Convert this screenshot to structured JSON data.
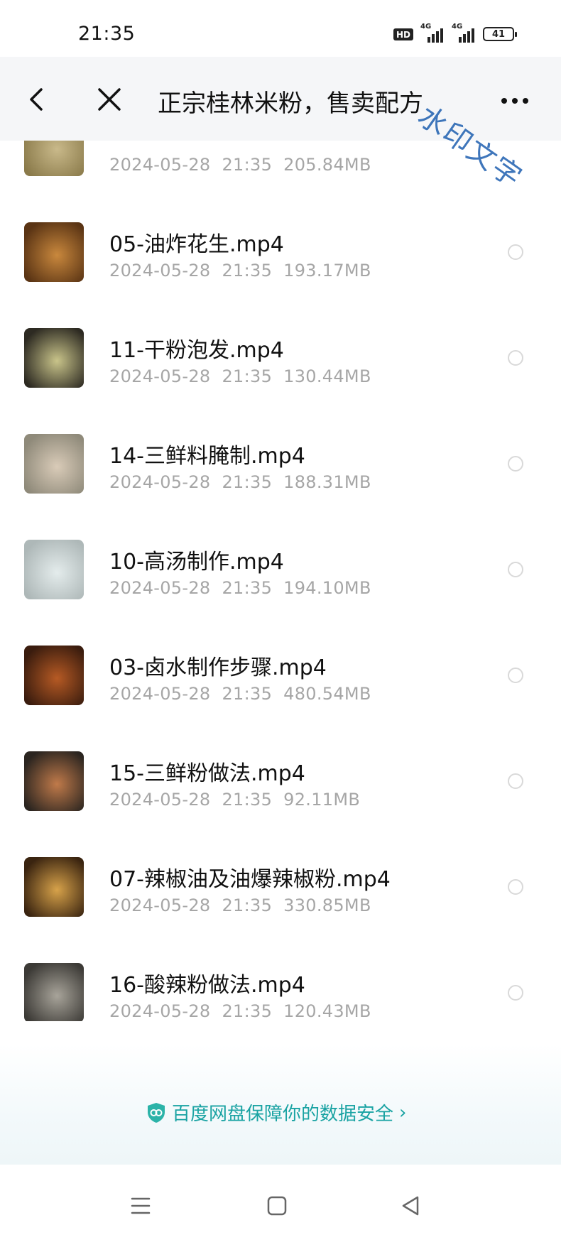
{
  "status_bar": {
    "time": "21:35",
    "hd_label": "HD",
    "net1_label": "4G",
    "net2_label": "4G",
    "battery_level": "41"
  },
  "header": {
    "title": "正宗桂林米粉，售卖配方",
    "back_icon": "chevron-left-icon",
    "close_icon": "close-icon",
    "more_icon": "more-icon",
    "watermark_text": "水印文字"
  },
  "files": [
    {
      "name": "",
      "date": "2024-05-28",
      "time": "21:35",
      "size": "205.84MB",
      "thumb_colors": [
        "#8a7a4a",
        "#c9b98a"
      ]
    },
    {
      "name": "05-油炸花生.mp4",
      "date": "2024-05-28",
      "time": "21:35",
      "size": "193.17MB",
      "thumb_colors": [
        "#5a3414",
        "#c9883d"
      ]
    },
    {
      "name": "11-干粉泡发.mp4",
      "date": "2024-05-28",
      "time": "21:35",
      "size": "130.44MB",
      "thumb_colors": [
        "#2d2a22",
        "#c9c48a"
      ]
    },
    {
      "name": "14-三鲜料腌制.mp4",
      "date": "2024-05-28",
      "time": "21:35",
      "size": "188.31MB",
      "thumb_colors": [
        "#8f8a7a",
        "#d9cbb8"
      ]
    },
    {
      "name": "10-高汤制作.mp4",
      "date": "2024-05-28",
      "time": "21:35",
      "size": "194.10MB",
      "thumb_colors": [
        "#aeb8b8",
        "#e4ecec"
      ]
    },
    {
      "name": "03-卤水制作步骤.mp4",
      "date": "2024-05-28",
      "time": "21:35",
      "size": "480.54MB",
      "thumb_colors": [
        "#3a1c0e",
        "#b65a24"
      ]
    },
    {
      "name": "15-三鲜粉做法.mp4",
      "date": "2024-05-28",
      "time": "21:35",
      "size": "92.11MB",
      "thumb_colors": [
        "#2b2520",
        "#c07a4a"
      ]
    },
    {
      "name": "07-辣椒油及油爆辣椒粉.mp4",
      "date": "2024-05-28",
      "time": "21:35",
      "size": "330.85MB",
      "thumb_colors": [
        "#3a2410",
        "#d7a24a"
      ]
    },
    {
      "name": "16-酸辣粉做法.mp4",
      "date": "2024-05-28",
      "time": "21:35",
      "size": "120.43MB",
      "thumb_colors": [
        "#3c3a36",
        "#a8a49a"
      ]
    }
  ],
  "security_banner": {
    "text": "百度网盘保障你的数据安全",
    "icon": "shield-icon",
    "accent": "#1aa3a3"
  },
  "nav_bar": {
    "menu_icon": "menu-icon",
    "home_icon": "home-square-icon",
    "back_icon": "back-triangle-icon"
  }
}
